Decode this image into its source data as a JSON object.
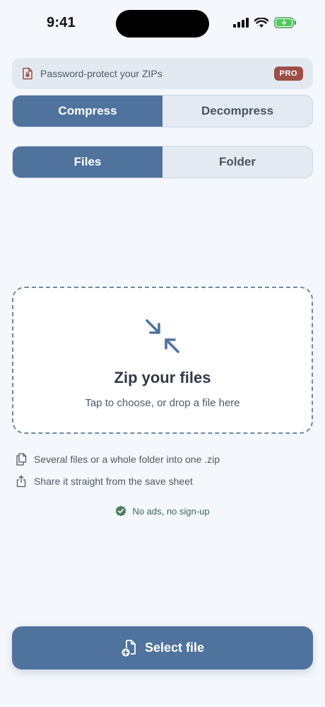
{
  "status_bar": {
    "time": "9:41"
  },
  "promo": {
    "text": "Password-protect your ZIPs",
    "badge": "PRO"
  },
  "mode_tabs": [
    {
      "label": "Compress",
      "active": true
    },
    {
      "label": "Decompress",
      "active": false
    }
  ],
  "source_tabs": [
    {
      "label": "Files",
      "active": true
    },
    {
      "label": "Folder",
      "active": false
    }
  ],
  "dropzone": {
    "title": "Zip your files",
    "subtitle": "Tap to choose, or drop a file here",
    "icon": "compress-arrows-icon"
  },
  "info": [
    {
      "icon": "files-icon",
      "text": "Several files or a whole folder into one .zip"
    },
    {
      "icon": "share-icon",
      "text": "Share it straight from the save sheet"
    }
  ],
  "badge_line": {
    "icon": "verified-check-icon",
    "text": "No ads, no sign-up"
  },
  "cta": {
    "label": "Select file",
    "icon": "add-file-icon"
  },
  "colors": {
    "accent": "#4f739d",
    "background": "#f4f7fb",
    "pro_badge": "#9b4f45",
    "success": "#3f6b55"
  }
}
